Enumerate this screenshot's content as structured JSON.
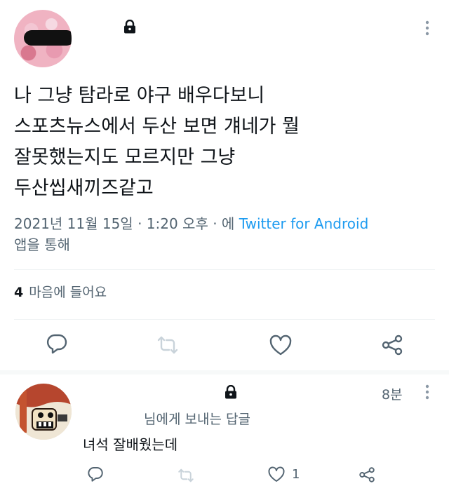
{
  "tweet": {
    "text_lines": [
      "나 그냥 탐라로 야구 배우다보니",
      "스포츠뉴스에서 두산 보면 걔네가 뭘",
      "잘못했는지도 모르지만 그냥",
      "두산씹새끼즈같고"
    ],
    "date_time": "2021년 11월 15일 · 1:20 오후 · 에",
    "client": "Twitter for Android",
    "via": "앱을 통해",
    "like_count": "4",
    "like_label": "마음에 들어요"
  },
  "reply": {
    "time": "8분",
    "reply_to": "님에게 보내는 답글",
    "text": "녀석 잘배웠는데",
    "like_count": "1"
  },
  "colors": {
    "text_primary": "#0f1419",
    "text_secondary": "#536471",
    "link": "#1d9bf0",
    "icon": "#536471",
    "retweet_disabled": "#c9d3da",
    "divider": "#eff3f4"
  }
}
